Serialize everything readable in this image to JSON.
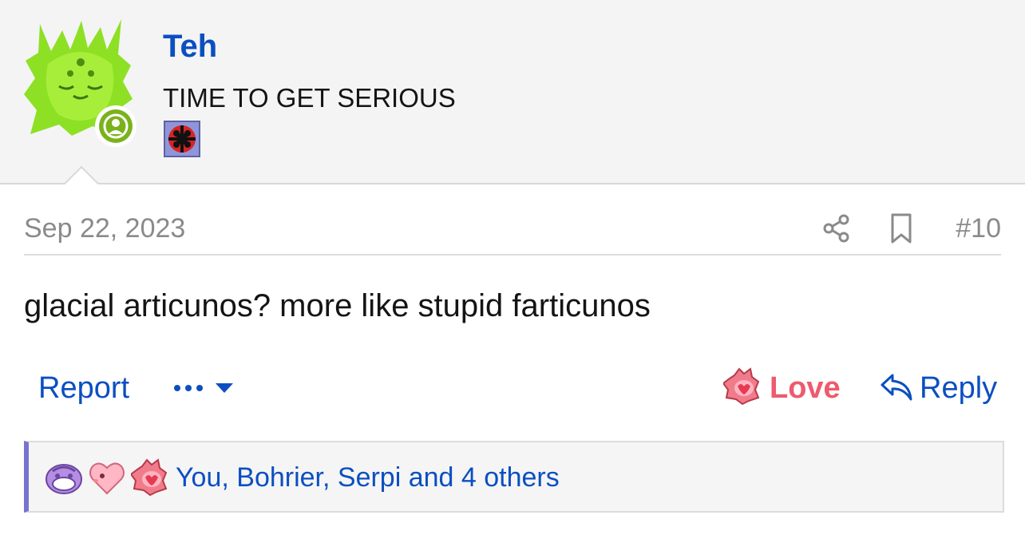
{
  "post": {
    "username": "Teh",
    "user_title": "TIME TO GET SERIOUS",
    "date": "Sep 22, 2023",
    "post_number": "#10",
    "body": "glacial articunos? more like stupid farticunos"
  },
  "actions": {
    "report": "Report",
    "more_icon": "ellipsis-caret-icon",
    "love": "Love",
    "reply": "Reply"
  },
  "reactions": {
    "summary": "You, Bohrier, Serpi and 4 others",
    "icons": [
      "purple-reaction-icon",
      "heart-reaction-icon",
      "love-reaction-icon"
    ]
  },
  "colors": {
    "link": "#0b4fc1",
    "love": "#ef5a6d",
    "online": "#7ab21c",
    "reaction_bar": "#7a72d0"
  }
}
